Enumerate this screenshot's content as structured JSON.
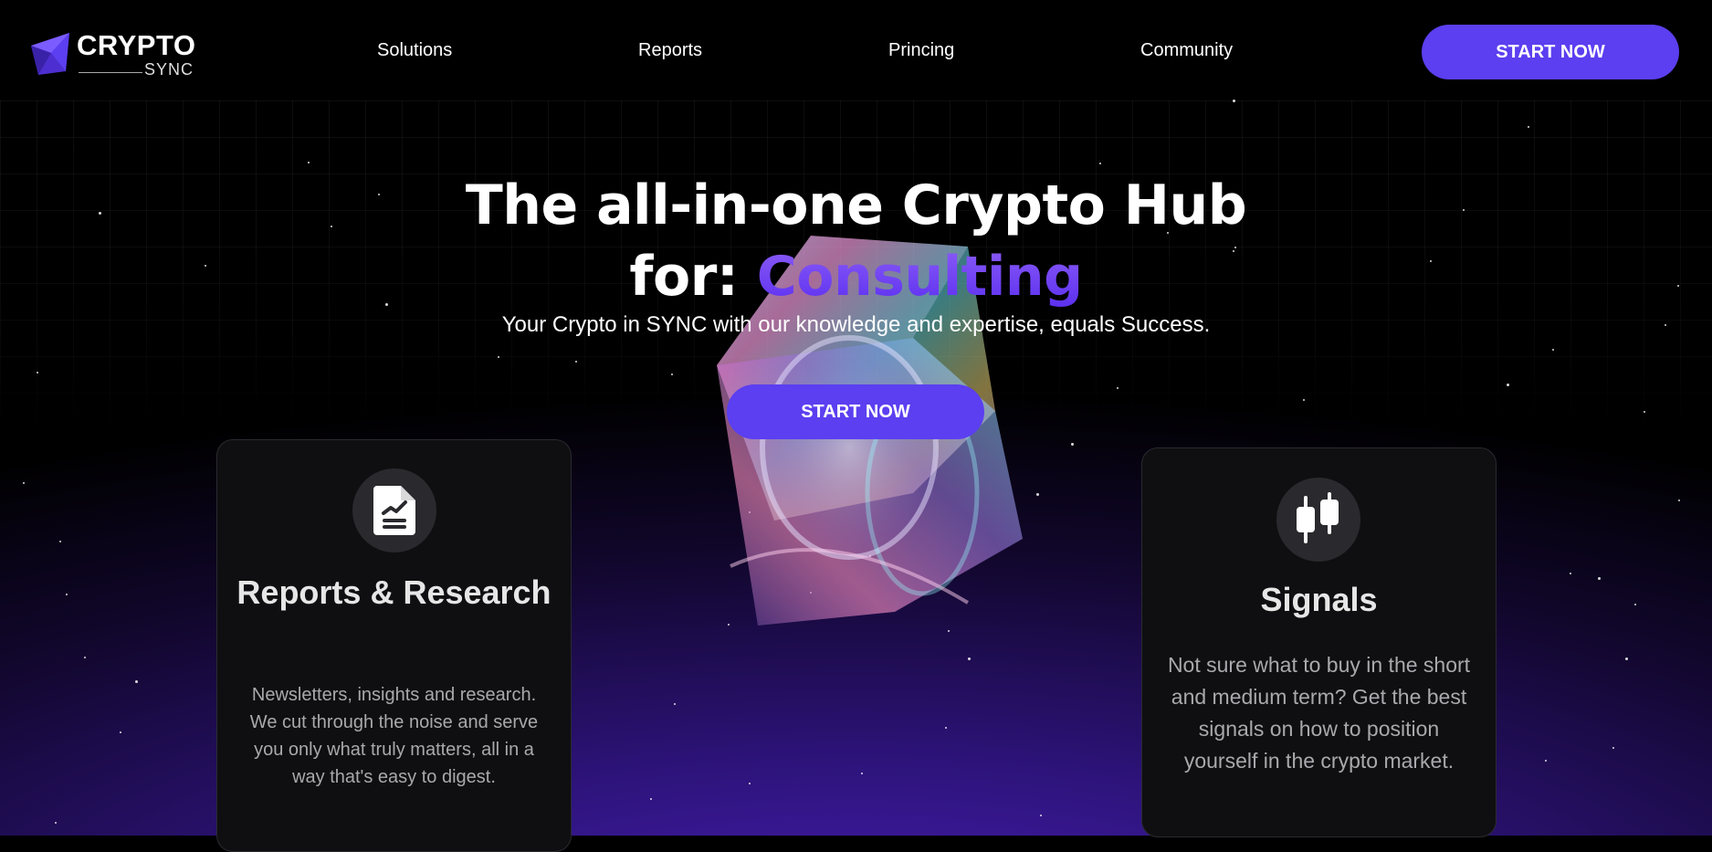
{
  "brand": {
    "name_top": "CRYPTO",
    "name_bottom": "SYNC"
  },
  "nav": {
    "links": [
      "Solutions",
      "Reports",
      "Princing",
      "Community"
    ],
    "cta_label": "START NOW"
  },
  "hero": {
    "title_line1": "The all-in-one Crypto Hub",
    "title_prefix": "for:",
    "title_rotating_word": "Consulting",
    "subtitle": "Your Crypto in SYNC with our knowledge and expertise, equals Success.",
    "cta_label": "START NOW"
  },
  "cards": [
    {
      "icon": "report-document-icon",
      "title": "Reports & Research",
      "text": "Newsletters, insights and research. We cut through the noise and serve you only what truly matters, all in a way that's easy to digest."
    },
    {
      "icon": "candlestick-chart-icon",
      "title": "Signals",
      "text": "Not sure what to buy in the short and medium term? Get the best signals on how to position yourself in the crypto market."
    }
  ],
  "colors": {
    "accent": "#5b3ff0",
    "accent_gradient_top": "#8b5cf6",
    "background": "#000000",
    "glow": "#4a1fb8",
    "card_bg": "#0f0f12"
  }
}
